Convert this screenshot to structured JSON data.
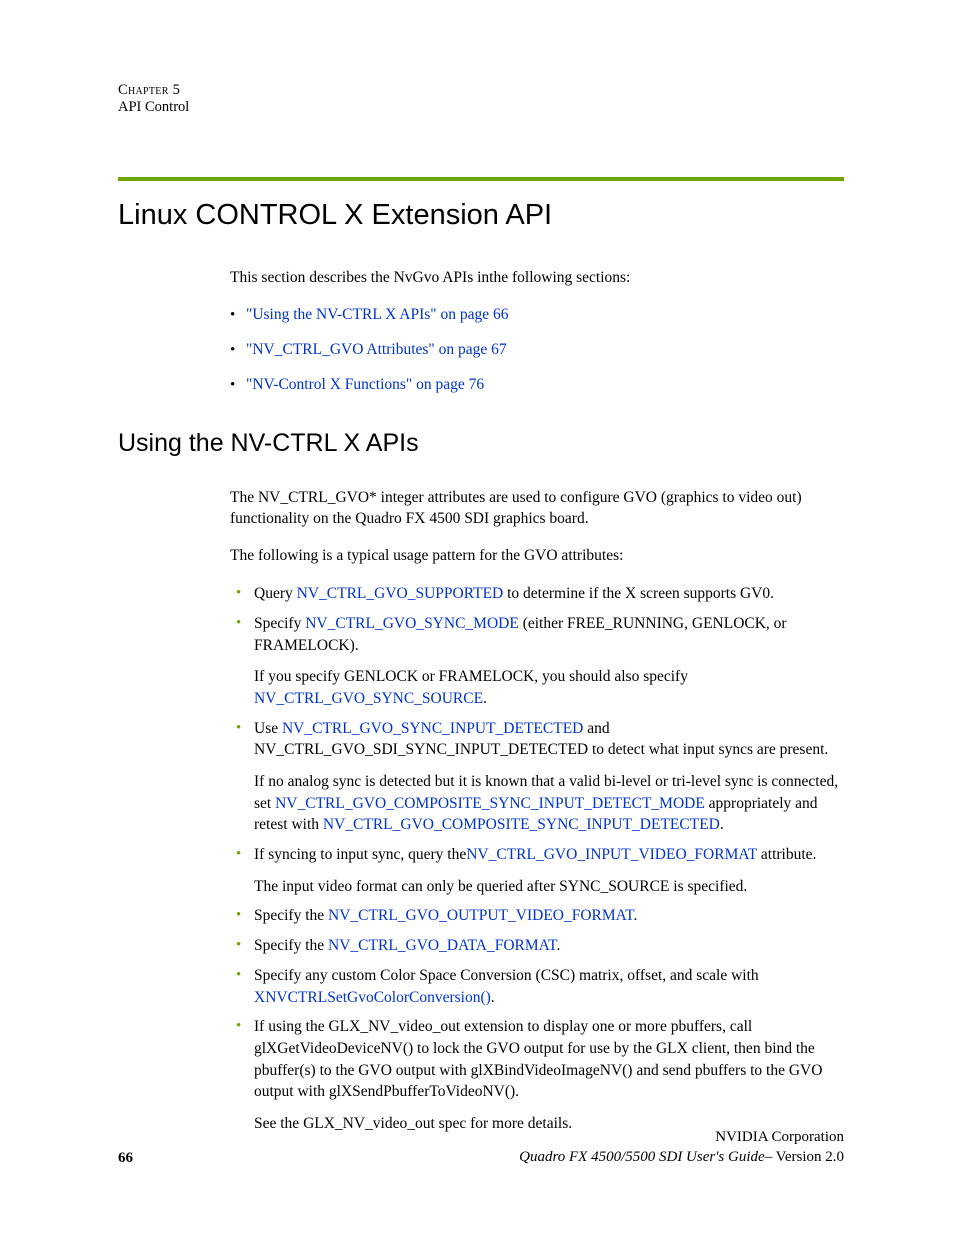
{
  "header": {
    "chapter": "Chapter 5",
    "title": "API Control"
  },
  "h1": "Linux CONTROL X Extension API",
  "intro": "This section describes the NvGvo APIs inthe following sections:",
  "toc": [
    {
      "text": "\"Using the NV-CTRL X APIs\" on page 66"
    },
    {
      "text": "\"NV_CTRL_GVO Attributes\" on page 67"
    },
    {
      "text": "\"NV-Control X Functions\" on page 76"
    }
  ],
  "h2": "Using the NV-CTRL X APIs",
  "para1": "The NV_CTRL_GVO* integer attributes are used to configure GVO (graphics to video out) functionality on the Quadro FX 4500 SDI graphics board.",
  "para2": "The following is a typical usage pattern for the GVO attributes:",
  "steps": {
    "s1": {
      "pre": "Query ",
      "link": "NV_CTRL_GVO_SUPPORTED",
      "post": " to determine if the X screen supports GV0."
    },
    "s2": {
      "pre": "Specify ",
      "link": "NV_CTRL_GVO_SYNC_MODE",
      "post": " (either FREE_RUNNING, GENLOCK, or FRAMELOCK).",
      "sub_pre": "If you specify GENLOCK or FRAMELOCK, you should also  specify ",
      "sub_link": "NV_CTRL_GVO_SYNC_SOURCE",
      "sub_post": "."
    },
    "s3": {
      "pre": "Use ",
      "link": "NV_CTRL_GVO_SYNC_INPUT_DETECTED",
      "post": " and NV_CTRL_GVO_SDI_SYNC_INPUT_DETECTED to detect what input syncs are present.",
      "sub_pre": "If no analog sync is detected but it is known that a valid bi-level or tri-level sync is connected,  set ",
      "sub_link1": "NV_CTRL_GVO_COMPOSITE_SYNC_INPUT_DETECT_MODE",
      "sub_mid": " appropriately and retest with ",
      "sub_link2": "NV_CTRL_GVO_COMPOSITE_SYNC_INPUT_DETECTED",
      "sub_post": "."
    },
    "s4": {
      "pre": "If syncing to input sync, query the",
      "link": "NV_CTRL_GVO_INPUT_VIDEO_FORMAT",
      "post": " attribute.",
      "sub": "The input video format can only be queried after SYNC_SOURCE is specified."
    },
    "s5": {
      "pre": "Specify the ",
      "link": "NV_CTRL_GVO_OUTPUT_VIDEO_FORMAT",
      "post": "."
    },
    "s6": {
      "pre": "Specify the ",
      "link": "NV_CTRL_GVO_DATA_FORMAT",
      "post": "."
    },
    "s7": {
      "pre": "Specify any custom Color Space Conversion (CSC) matrix, offset, and scale with ",
      "link": "XNVCTRLSetGvoColorConversion()",
      "post": "."
    },
    "s8": {
      "main": "If using the GLX_NV_video_out extension to display one or more pbuffers, call glXGetVideoDeviceNV() to lock the GVO output for use by the GLX client, then bind the pbuffer(s) to the GVO output with glXBindVideoImageNV() and send pbuffers to the GVO output with glXSendPbufferToVideoNV().",
      "sub": "See the GLX_NV_video_out spec for more details."
    }
  },
  "footer": {
    "company": "NVIDIA Corporation",
    "doc_title": "Quadro FX 4500/5500 SDI User's Guide",
    "version": "– Version 2.0",
    "page": "66"
  }
}
